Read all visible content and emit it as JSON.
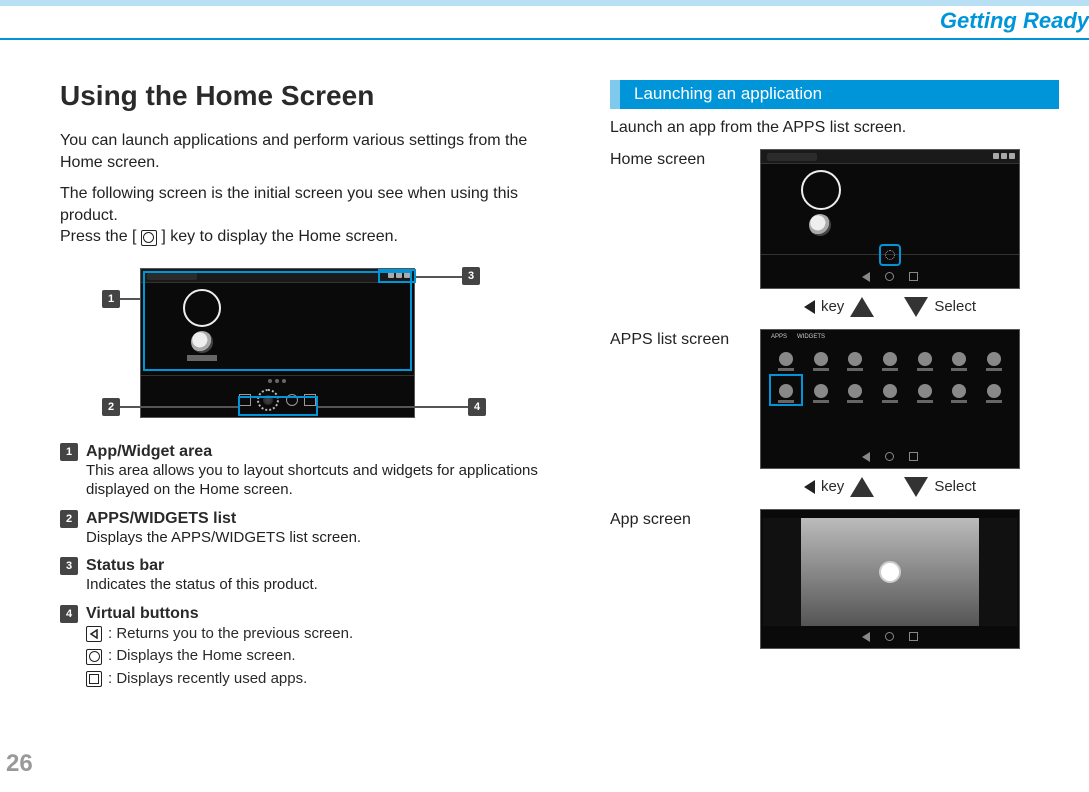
{
  "header": {
    "chapter": "Getting Ready"
  },
  "page_number": "26",
  "left": {
    "title": "Using the Home Screen",
    "intro1": "You can launch applications and perform various settings from the Home screen.",
    "intro2a": "The following screen is the initial screen you see when using this product.",
    "intro2b_prefix": "Press the [",
    "intro2b_suffix": "] key to display the Home screen.",
    "callouts": {
      "n1": "1",
      "n2": "2",
      "n3": "3",
      "n4": "4"
    },
    "defs": {
      "d1": {
        "num": "1",
        "title": "App/Widget area",
        "desc": "This area allows you to layout shortcuts and widgets for applications displayed on the Home screen."
      },
      "d2": {
        "num": "2",
        "title": "APPS/WIDGETS list",
        "desc": "Displays the APPS/WIDGETS list screen."
      },
      "d3": {
        "num": "3",
        "title": "Status bar",
        "desc": "Indicates the status of this product."
      },
      "d4": {
        "num": "4",
        "title": "Virtual buttons",
        "s1": ": Returns you to the previous screen.",
        "s2": ": Displays the Home screen.",
        "s3": ": Displays recently used apps."
      }
    }
  },
  "right": {
    "section_title": "Launching an application",
    "intro": "Launch an app from the APPS list screen.",
    "row1_label": "Home screen",
    "row2_label": "APPS list screen",
    "row3_label": "App screen",
    "nav_key": "key",
    "nav_select": "Select",
    "apps_tabs": {
      "a": "APPS",
      "b": "WIDGETS"
    }
  }
}
